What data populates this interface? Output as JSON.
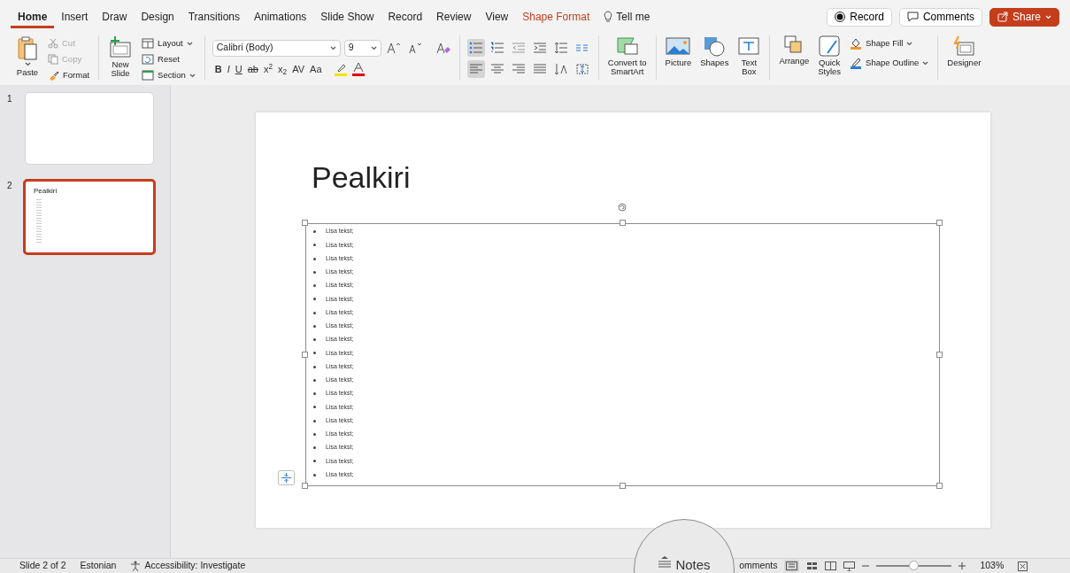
{
  "tabs": [
    {
      "label": "Home",
      "selected": true,
      "kind": "normal"
    },
    {
      "label": "Insert",
      "selected": false,
      "kind": "normal"
    },
    {
      "label": "Draw",
      "selected": false,
      "kind": "normal"
    },
    {
      "label": "Design",
      "selected": false,
      "kind": "normal"
    },
    {
      "label": "Transitions",
      "selected": false,
      "kind": "normal"
    },
    {
      "label": "Animations",
      "selected": false,
      "kind": "normal"
    },
    {
      "label": "Slide Show",
      "selected": false,
      "kind": "normal"
    },
    {
      "label": "Record",
      "selected": false,
      "kind": "normal"
    },
    {
      "label": "Review",
      "selected": false,
      "kind": "normal"
    },
    {
      "label": "View",
      "selected": false,
      "kind": "normal"
    },
    {
      "label": "Shape Format",
      "selected": false,
      "kind": "contextual"
    }
  ],
  "tell_me": "Tell me",
  "header_buttons": {
    "record": "Record",
    "comments": "Comments",
    "share": "Share"
  },
  "clipboard": {
    "paste": "Paste",
    "cut": {
      "label": "Cut",
      "disabled": true
    },
    "copy": {
      "label": "Copy",
      "disabled": true
    },
    "format": {
      "label": "Format",
      "disabled": false
    }
  },
  "slides": {
    "new_slide": "New\nSlide",
    "layout": "Layout",
    "reset": "Reset",
    "section": "Section"
  },
  "font": {
    "name": "Calibri (Body)",
    "size": "9",
    "format_buttons": [
      "B",
      "I",
      "U",
      "ab",
      "x$^{2}$",
      "x$_{2}$",
      "AV",
      "Aa"
    ]
  },
  "paragraph": {
    "bullets": {
      "selected": true
    },
    "numbering": {
      "selected": false
    },
    "alignment": [
      {
        "selected": true
      },
      {
        "selected": false
      },
      {
        "selected": false
      },
      {
        "selected": false
      }
    ]
  },
  "convert": "Convert to\nSmartArt",
  "insert": {
    "picture": "Picture",
    "shapes": "Shapes",
    "text_box": "Text\nBox"
  },
  "drawing": {
    "arrange": "Arrange",
    "quick_styles": "Quick\nStyles",
    "shape_fill": "Shape Fill",
    "shape_outline": "Shape Outline"
  },
  "designer": "Designer",
  "thumbnails": [
    {
      "number": "1",
      "selected": false
    },
    {
      "number": "2",
      "selected": true,
      "title": "Pealkiri"
    }
  ],
  "slide": {
    "title": "Pealkiri",
    "bullets": [
      "Lisa tekst;",
      "Lisa tekst;",
      "Lisa tekst;",
      "Lisa tekst;",
      "Lisa tekst;",
      "Lisa tekst;",
      "Lisa tekst;",
      "Lisa tekst;",
      "Lisa tekst;",
      "Lisa tekst;",
      "Lisa tekst;",
      "Lisa tekst;",
      "Lisa tekst;",
      "Lisa tekst;",
      "Lisa tekst;",
      "Lisa tekst;",
      "Lisa tekst;",
      "Lisa tekst;",
      "Lisa tekst;"
    ]
  },
  "status_bar": {
    "slide_count": "Slide 2 of 2",
    "language": "Estonian",
    "accessibility": "Accessibility: Investigate",
    "notes": "Notes",
    "comments": "omments",
    "zoom": {
      "level": 0.5
    },
    "zoom_text": "103%"
  }
}
